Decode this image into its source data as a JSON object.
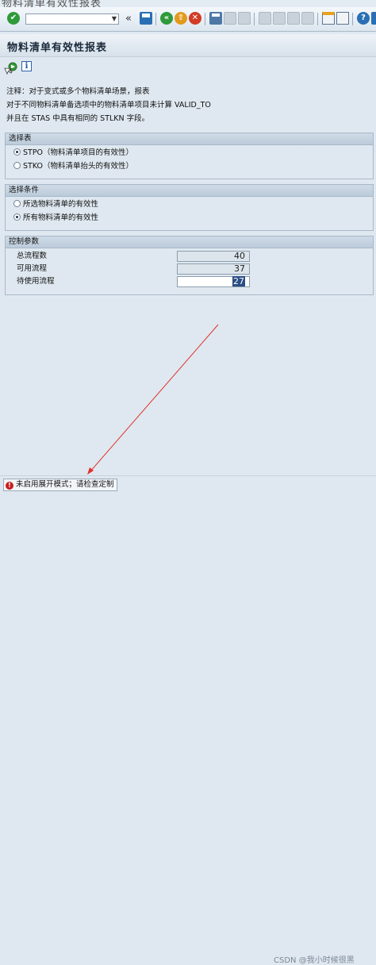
{
  "window_title_fragment": "物料清单有效性报表",
  "toolbar": {
    "icons": [
      "enter-icon",
      "command-field",
      "back-icon",
      "save-icon",
      "back-nav-icon",
      "exit-icon",
      "cancel-icon",
      "print-icon",
      "find-icon",
      "find-next-icon",
      "first-page-icon",
      "prev-page-icon",
      "next-page-icon",
      "last-page-icon",
      "new-session-icon",
      "shortcut-icon",
      "help-icon",
      "customize-icon"
    ],
    "command_value": "",
    "double_chevron": "«"
  },
  "page_title": "物料清单有效性报表",
  "app_toolbar": {
    "info_glyph": "i"
  },
  "note": {
    "line1": "注释：对于变式或多个物料清单场景，报表",
    "line2": "对于不同物料清单备选项中的物料清单项目未计算 VALID_TO",
    "line3": "并且在 STAS 中具有相同的 STLKN 字段。"
  },
  "group_table": {
    "title": "选择表",
    "options": [
      {
        "label": "STPO（物料清单项目的有效性）",
        "selected": true
      },
      {
        "label": "STKO（物料清单抬头的有效性）",
        "selected": false
      }
    ]
  },
  "group_condition": {
    "title": "选择条件",
    "options": [
      {
        "label": "所选物料清单的有效性",
        "selected": false
      },
      {
        "label": "所有物料清单的有效性",
        "selected": true
      }
    ]
  },
  "group_control": {
    "title": "控制参数",
    "fields": [
      {
        "label": "总流程数",
        "value": "40",
        "editable": false
      },
      {
        "label": "可用流程",
        "value": "37",
        "editable": false
      },
      {
        "label": "待使用流程",
        "value": "27",
        "editable": true
      }
    ]
  },
  "status": {
    "message": "未启用展开模式；请检查定制",
    "type": "error"
  },
  "watermark": "CSDN @我小时候很黑",
  "colors": {
    "annotation_arrow": "#e0302a",
    "selection": "#2c4e86",
    "error": "#c81e1e"
  }
}
